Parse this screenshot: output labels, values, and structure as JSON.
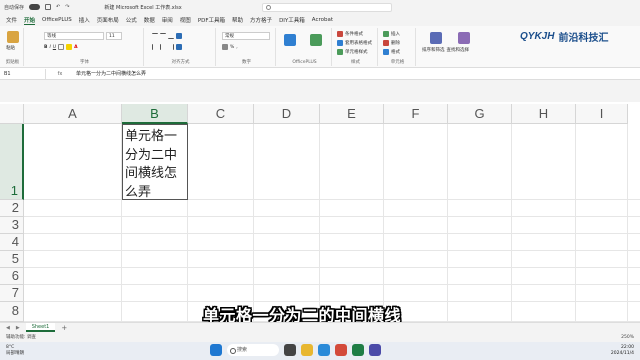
{
  "titlebar": {
    "autosave": "自动保存",
    "doc_title": "新建 Microsoft Excel 工作表.xlsx",
    "search_placeholder": "搜索"
  },
  "menu": [
    "文件",
    "开始",
    "OfficePLUS",
    "插入",
    "页面布局",
    "公式",
    "数据",
    "审阅",
    "视图",
    "PDF工具箱",
    "帮助",
    "方方格子",
    "DIY工具箱",
    "Acrobat"
  ],
  "active_menu": "开始",
  "ribbon": {
    "paste": "粘贴",
    "clipboard": "剪贴板",
    "font_name": "等线",
    "font_size": "11",
    "font_group": "字体",
    "align_group": "对齐方式",
    "number_format": "常规",
    "number_group": "数字",
    "officeplus_group": "OfficePLUS",
    "conditional_format": "条件格式",
    "table_format": "套用表格格式",
    "cell_style": "单元格样式",
    "styles_group": "样式",
    "insert": "插入",
    "delete": "删除",
    "format": "格式",
    "cells_group": "单元格",
    "sort_filter": "排序和筛选",
    "find_select": "查找和选择",
    "table_style": "表格样式",
    "cell_style_short": "单元格样式"
  },
  "logo": {
    "en": "QYKJH",
    "cn": "前沿科技汇"
  },
  "formula_bar": {
    "name_box": "B1",
    "fx": "fx",
    "content": "单元格一分为二中间横线怎么弄"
  },
  "columns": [
    "A",
    "B",
    "C",
    "D",
    "E",
    "F",
    "G",
    "H",
    "I"
  ],
  "selected_column": "B",
  "rows": [
    "1",
    "2",
    "3",
    "4",
    "5",
    "6",
    "7",
    "8"
  ],
  "selected_row": "1",
  "active_cell_text": "单元格一分为二中间横线怎么弄",
  "caption": "单元格一分为二的中间横线",
  "sheet": {
    "tab": "Sheet1"
  },
  "status": {
    "ready": "辅助功能: 调查",
    "zoom": "250%"
  },
  "taskbar": {
    "temp": "8°C",
    "weather": "局部晴朗",
    "search": "搜索",
    "time": "22:00",
    "date": "2024/11/4"
  },
  "colors": {
    "accent": "#1e6c3a",
    "logo": "#1c4f8c"
  }
}
